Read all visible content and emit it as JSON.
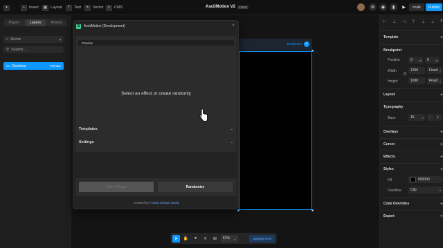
{
  "topbar": {
    "menu_items": [
      "Insert",
      "Layout",
      "Text",
      "Vector",
      "CMS"
    ],
    "project_title": "AsciiMotion V2",
    "project_badge": "FREE",
    "invite_label": "Invite",
    "publish_label": "Publish"
  },
  "left_panel": {
    "tabs": [
      "Pages",
      "Layers",
      "Assets"
    ],
    "page_select": "Home",
    "search_placeholder": "Search...",
    "layer": {
      "name": "Desktop",
      "tag": "Primary"
    }
  },
  "canvas": {
    "breakpoint_label": "Breakpoint"
  },
  "plugin": {
    "title": "AsciiMotion (Development)",
    "close": "×",
    "preview_label": "Preview",
    "empty_state": "Select an effect or create randomly",
    "sections": [
      "Templates",
      "Settings"
    ],
    "primary_button": "Edit in Plugin",
    "secondary_button": "Randomize",
    "credit_prefix": "Created by ",
    "credit_link": "Framia Design Studio"
  },
  "bottom_toolbar": {
    "zoom": "61%",
    "upgrade_label": "Upgrade Now"
  },
  "right_panel": {
    "template_label": "Template",
    "breakpoint_label": "Breakpoint",
    "position_label": "Position",
    "position_x": "0",
    "position_y": "0",
    "width_label": "Width",
    "width_value": "1200",
    "width_mode": "Fixed",
    "height_label": "Height",
    "height_value": "1000",
    "height_mode": "Fixed",
    "layout_label": "Layout",
    "typography_label": "Typography",
    "base_label": "Base",
    "base_value": "16",
    "overlays_label": "Overlays",
    "cursor_label": "Cursor",
    "effects_label": "Effects",
    "styles_label": "Styles",
    "fill_label": "Fill",
    "fill_value": "000000",
    "overflow_label": "Overflow",
    "overflow_value": "Clip",
    "code_overrides_label": "Code Overrides",
    "export_label": "Export"
  },
  "colors": {
    "accent": "#0d99ff",
    "plugin_logo": "#3ecf8e",
    "background": "#171717"
  }
}
